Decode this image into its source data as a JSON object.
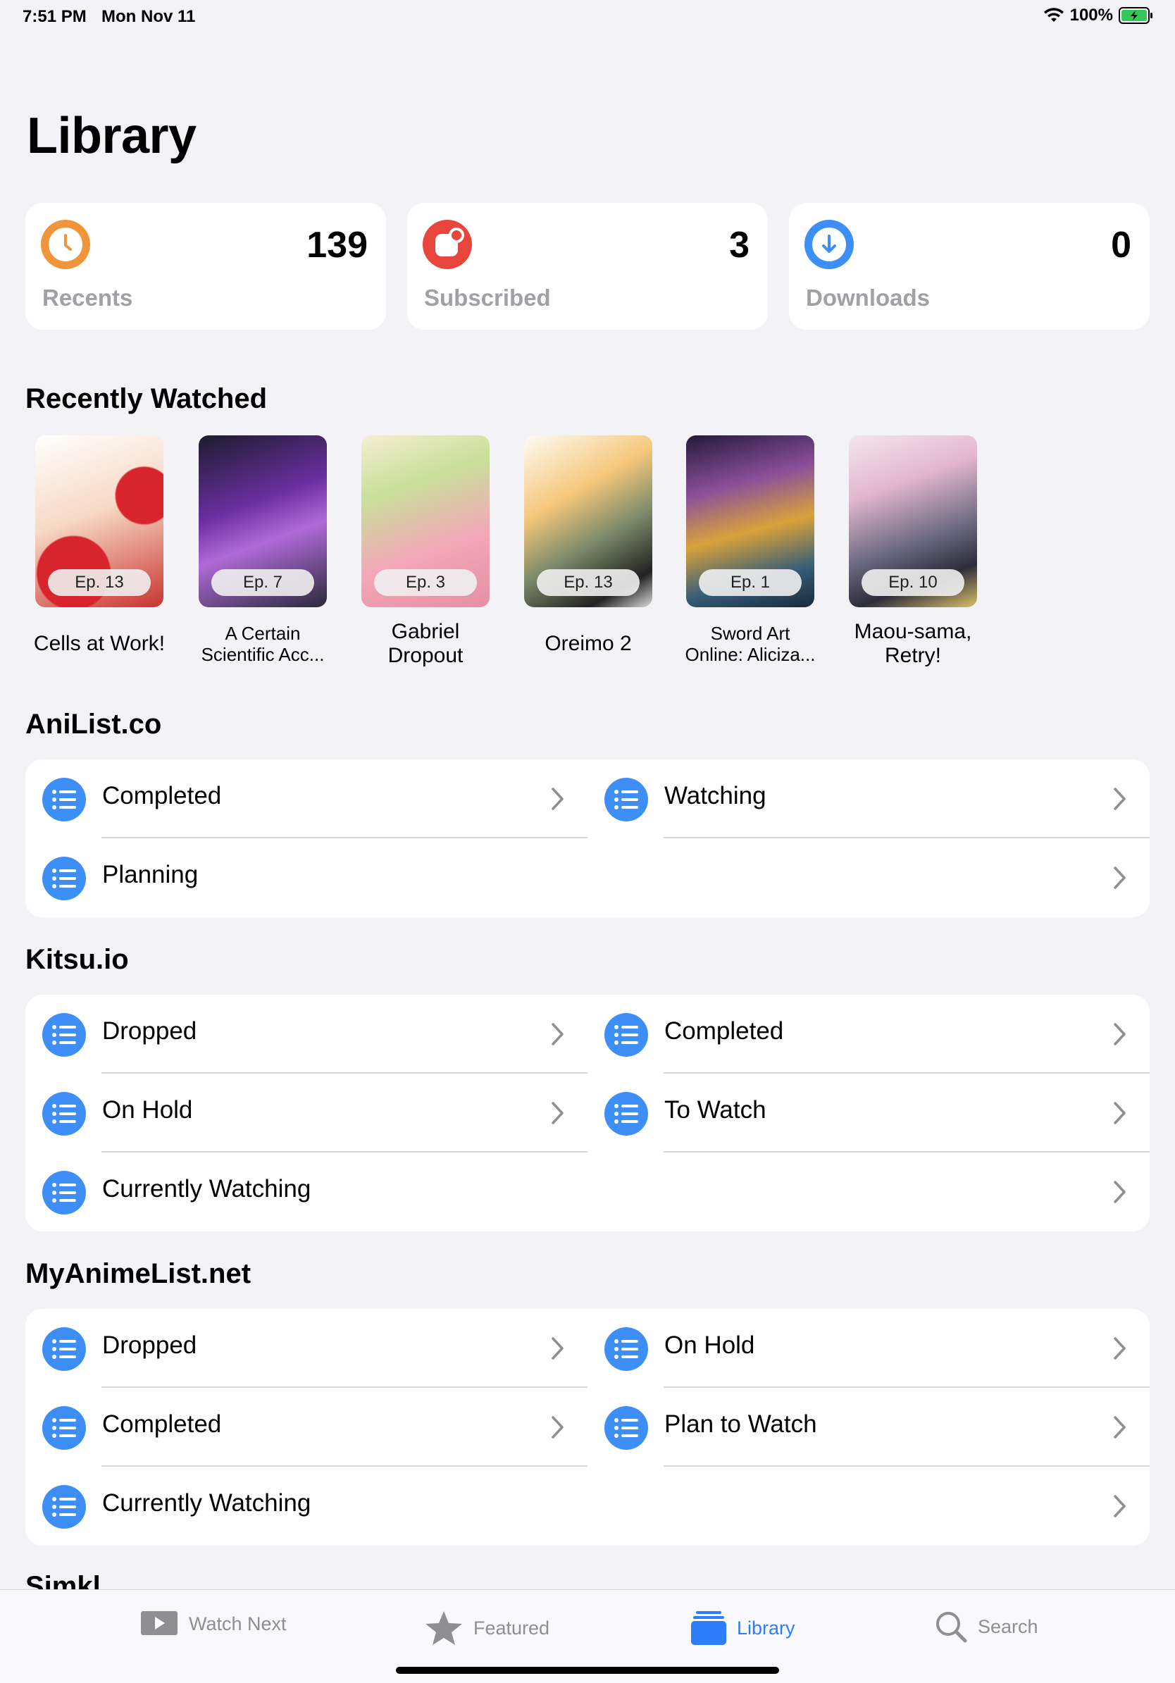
{
  "status": {
    "time": "7:51 PM",
    "date": "Mon Nov 11",
    "battery": "100%"
  },
  "page_title": "Library",
  "stats": [
    {
      "label": "Recents",
      "count": "139",
      "icon": "clock-icon",
      "color": "#f0953a"
    },
    {
      "label": "Subscribed",
      "count": "3",
      "icon": "subscribed-icon",
      "color": "#e8453c"
    },
    {
      "label": "Downloads",
      "count": "0",
      "icon": "download-icon",
      "color": "#3e8ef7"
    }
  ],
  "recently_watched": {
    "heading": "Recently Watched",
    "items": [
      {
        "ep": "Ep. 13",
        "title": "Cells at Work!"
      },
      {
        "ep": "Ep. 7",
        "title_l1": "A Certain",
        "title_l2": "Scientific Acc..."
      },
      {
        "ep": "Ep. 3",
        "title_l1": "Gabriel",
        "title_l2": "Dropout"
      },
      {
        "ep": "Ep. 13",
        "title": "Oreimo 2"
      },
      {
        "ep": "Ep. 1",
        "title_l1": "Sword Art",
        "title_l2": "Online: Aliciza..."
      },
      {
        "ep": "Ep. 10",
        "title_l1": "Maou-sama,",
        "title_l2": "Retry!"
      }
    ]
  },
  "anilist": {
    "heading": "AniList.co",
    "items": [
      "Completed",
      "Watching",
      "Planning"
    ]
  },
  "kitsu": {
    "heading": "Kitsu.io",
    "items": [
      "Dropped",
      "Completed",
      "On Hold",
      "To Watch",
      "Currently Watching"
    ]
  },
  "mal": {
    "heading": "MyAnimeList.net",
    "items": [
      "Dropped",
      "On Hold",
      "Completed",
      "Plan to Watch",
      "Currently Watching"
    ]
  },
  "simkl": {
    "heading": "Simkl"
  },
  "tabs": [
    {
      "label": "Watch Next",
      "icon": "play-icon"
    },
    {
      "label": "Featured",
      "icon": "star-icon"
    },
    {
      "label": "Library",
      "icon": "library-icon"
    },
    {
      "label": "Search",
      "icon": "search-icon"
    }
  ],
  "colors": {
    "accent": "#2f7df6",
    "list_icon": "#3e8ef7"
  }
}
